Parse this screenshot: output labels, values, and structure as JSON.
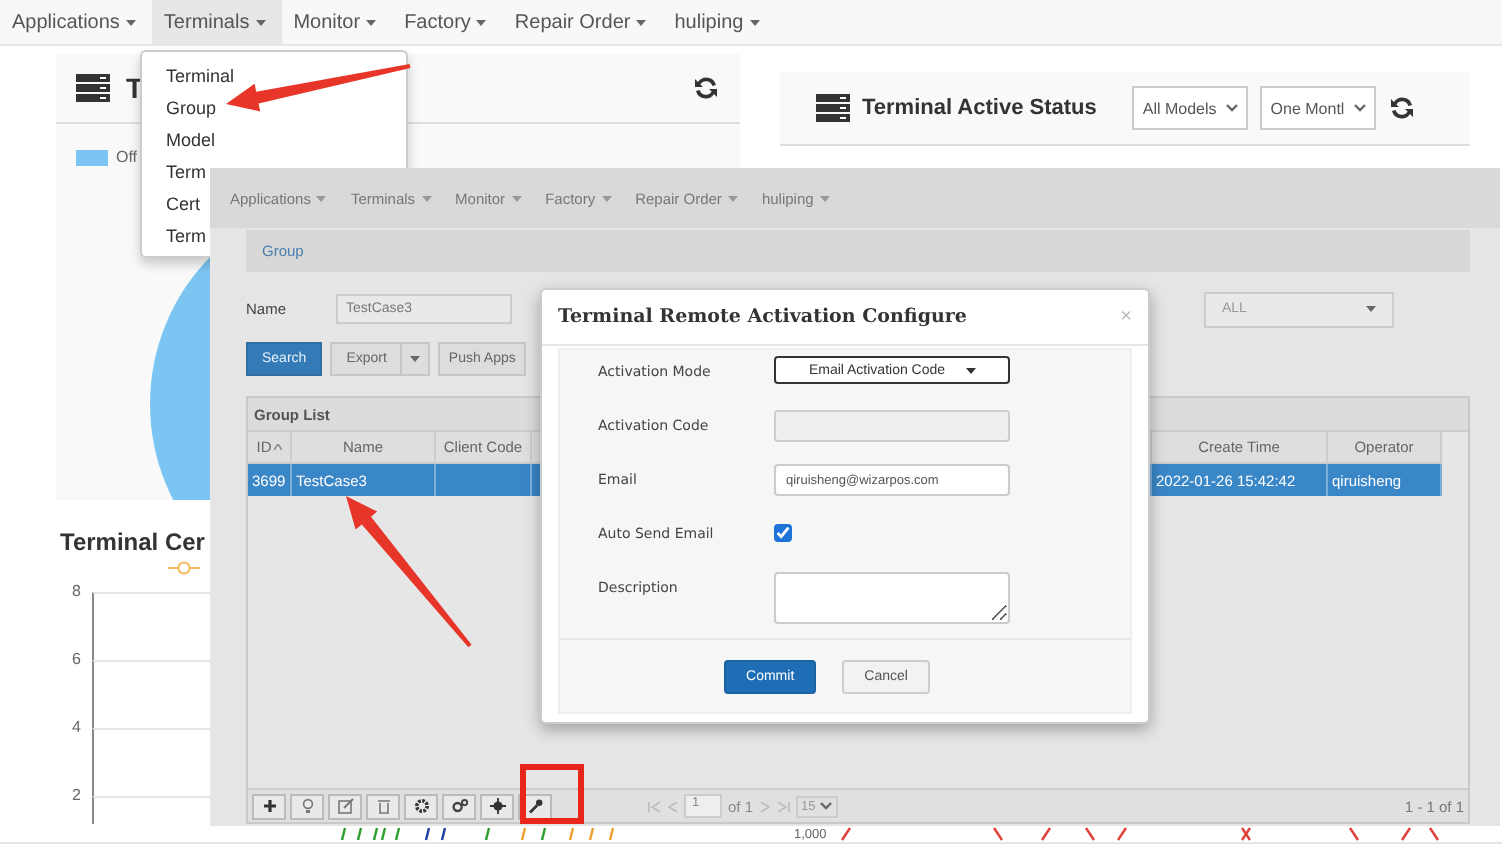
{
  "page": {
    "nav": [
      {
        "label": "Applications",
        "selected": false
      },
      {
        "label": "Terminals",
        "selected": true
      },
      {
        "label": "Monitor",
        "selected": false
      },
      {
        "label": "Factory",
        "selected": false
      },
      {
        "label": "Repair Order",
        "selected": false
      },
      {
        "label": "huliping",
        "selected": false
      }
    ],
    "device_card": {
      "title": "T",
      "legend": [
        {
          "label": "Off",
          "color": "#7cc5f2"
        }
      ]
    },
    "certificate_card": {
      "title": "Terminal Cer",
      "y_ticks": [
        "8",
        "6",
        "4",
        "2"
      ]
    },
    "active_status_card": {
      "title": "Terminal Active Status",
      "model_filter": "All Models",
      "period_filter": "One Montl"
    },
    "bottom_chart": {
      "y_label": "1,000"
    }
  },
  "terminals_menu": {
    "items": [
      "Terminal",
      "Group",
      "Model",
      "Term",
      "Cert",
      "Term"
    ]
  },
  "embedded_screenshot": {
    "nav": [
      "Applications",
      "Terminals",
      "Monitor",
      "Factory",
      "Repair Order",
      "huliping"
    ],
    "breadcrumb": "Group",
    "filters": {
      "name_label": "Name",
      "name_value": "TestCase3",
      "status_value": "ALL"
    },
    "buttons": {
      "search": "Search",
      "export": "Export",
      "push": "Push Apps"
    },
    "grid": {
      "title": "Group List",
      "columns": [
        {
          "label": "ID",
          "sorted": true
        },
        {
          "label": "Name",
          "sorted": false
        },
        {
          "label": "Client Code",
          "sorted": false
        },
        {
          "label": "Create Time",
          "sorted": false
        },
        {
          "label": "Operator",
          "sorted": false
        }
      ],
      "rows": [
        {
          "selected": true,
          "id": "3699",
          "name": "TestCase3",
          "create_time": "2022-01-26 15:42:42",
          "operator": "qiruisheng"
        }
      ],
      "tools": [
        {
          "kind": "add"
        },
        {
          "kind": "bulb"
        },
        {
          "kind": "edit"
        },
        {
          "kind": "delete"
        },
        {
          "kind": "gear"
        },
        {
          "kind": "gears"
        },
        {
          "kind": "target"
        },
        {
          "kind": "wrench"
        }
      ],
      "pager": {
        "page": "1",
        "of": "of 1",
        "page_size": "15",
        "summary": "1 - 1 of 1"
      }
    }
  },
  "modal": {
    "title": "Terminal Remote Activation Configure",
    "close": "×",
    "fields": [
      {
        "kind": "select",
        "label": "Activation Mode",
        "value": "Email Activation Code"
      },
      {
        "kind": "text",
        "label": "Activation Code",
        "disabled": true
      },
      {
        "kind": "text",
        "label": "Email",
        "value": "qiruisheng@wizarpos.com",
        "disabled": false
      },
      {
        "kind": "checkbox",
        "label": "Auto Send Email",
        "checked": true
      },
      {
        "kind": "textarea",
        "label": "Description"
      }
    ],
    "buttons": [
      {
        "label": "Commit",
        "primary": true
      },
      {
        "label": "Cancel",
        "primary": false
      }
    ]
  },
  "annotations": [
    {
      "kind": "arrow"
    },
    {
      "kind": "arrow"
    },
    {
      "kind": "frame"
    }
  ]
}
